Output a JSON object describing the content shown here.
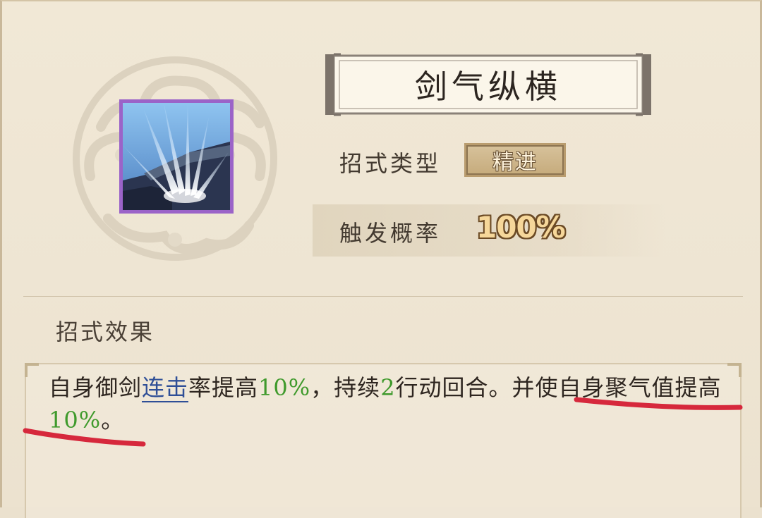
{
  "skill": {
    "name": "剑气纵横",
    "icon": "sword-qi-burst-icon",
    "type_label": "招式类型",
    "type_value": "精进",
    "trigger_label": "触发概率",
    "trigger_value": "100%"
  },
  "effect": {
    "heading": "招式效果",
    "segments": {
      "s1": "自身御剑",
      "s2": "连击",
      "s3": "率提高",
      "s4": "10%",
      "s5": "，持续",
      "s6": "2",
      "s7": "行动回合。并使自身聚气值提高",
      "s8": "10%",
      "s9": "。"
    }
  },
  "colors": {
    "icon_border": "#9b63c8",
    "highlight_number": "#3f9a2c",
    "highlight_link": "#2f4f97",
    "annotation_red": "#d6283c",
    "trigger_value": "#f6d79a"
  }
}
